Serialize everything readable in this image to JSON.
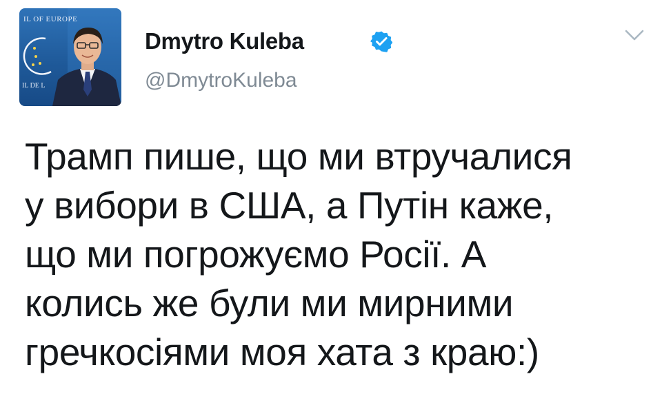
{
  "tweet": {
    "author": {
      "display_name": "Dmytro Kuleba",
      "handle": "@DmytroKuleba",
      "verified": true,
      "avatar": {
        "banner_top_text": "IL OF EUROPE",
        "banner_left_text": "IL DE L"
      }
    },
    "text": "Трамп пише, що ми втручалися\nу вибори в США, а Путін каже,\nщо ми погрожуємо Росії. А\nколись же були ми мирними\nгречкосіями моя хата з краю:)"
  },
  "icons": {
    "verified": "verified-badge-icon",
    "menu": "chevron-down-icon"
  },
  "colors": {
    "verified_blue": "#1da1f2",
    "handle_gray": "#7f8a94",
    "text_dark": "#14171a",
    "chevron_gray": "#aab8c2"
  }
}
